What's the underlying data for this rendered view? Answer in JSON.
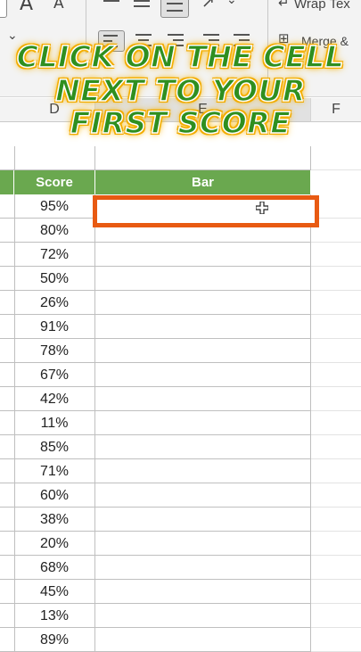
{
  "ribbon": {
    "font_a_large": "A",
    "font_a_small": "A",
    "wrap_text": "Wrap Tex",
    "merge": "Merge &",
    "chevron": "⌄"
  },
  "overlay": {
    "line1": "CLICK ON THE CELL",
    "line2": "NEXT TO YOUR",
    "line3": "FIRST SCORE"
  },
  "columns": {
    "d": "D",
    "e": "E",
    "f": "F"
  },
  "table": {
    "header_score": "Score",
    "header_bar": "Bar",
    "scores": [
      "95%",
      "80%",
      "72%",
      "50%",
      "26%",
      "91%",
      "78%",
      "67%",
      "42%",
      "11%",
      "85%",
      "71%",
      "60%",
      "38%",
      "20%",
      "68%",
      "45%",
      "13%",
      "89%"
    ]
  },
  "colors": {
    "header_green": "#6aa84f",
    "overlay_green": "#2f8f1f",
    "overlay_glow": "#f6b400",
    "selection_orange": "#e85a12"
  }
}
